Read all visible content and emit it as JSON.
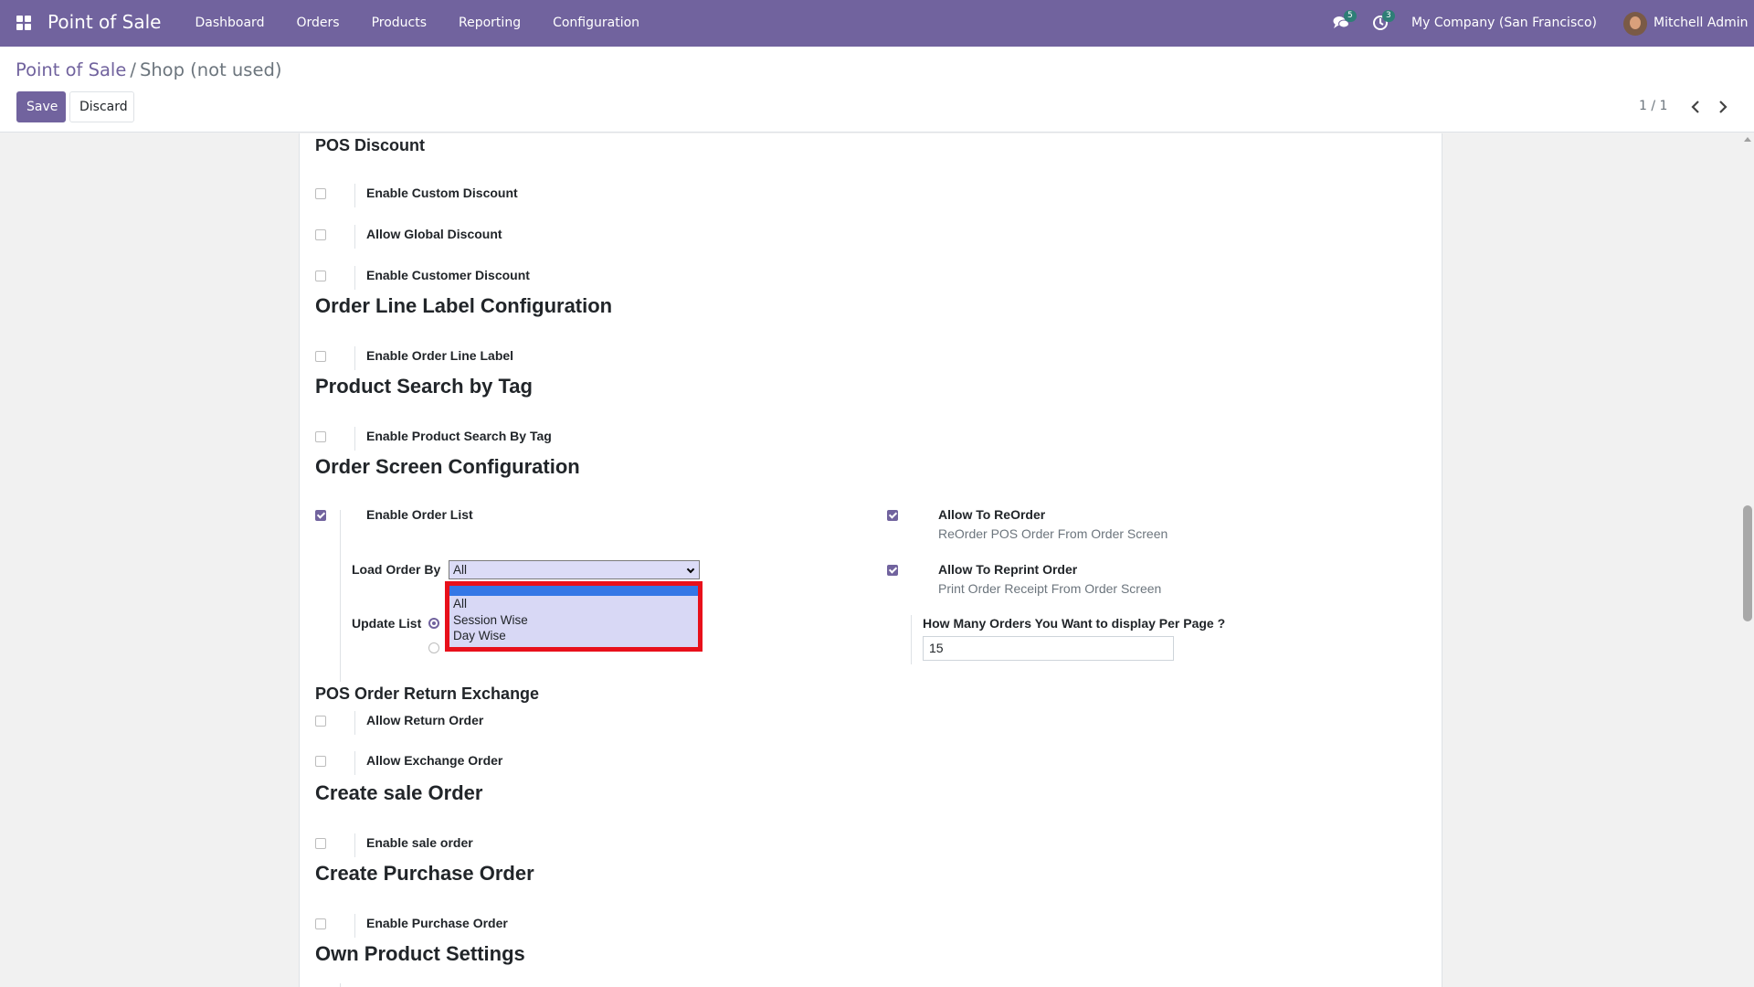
{
  "navbar": {
    "brand": "Point of Sale",
    "menu": [
      "Dashboard",
      "Orders",
      "Products",
      "Reporting",
      "Configuration"
    ],
    "chat_count": "5",
    "activity_count": "3",
    "company": "My Company (San Francisco)",
    "user": "Mitchell Admin"
  },
  "breadcrumb": {
    "parent": "Point of Sale",
    "separator": "/",
    "current": "Shop (not used)"
  },
  "buttons": {
    "save": "Save",
    "discard": "Discard"
  },
  "pager": "1 / 1",
  "sections": {
    "pos_discount": {
      "title": "POS Discount",
      "items": [
        {
          "label": "Enable Custom Discount",
          "checked": false
        },
        {
          "label": "Allow Global Discount",
          "checked": false
        },
        {
          "label": "Enable Customer Discount",
          "checked": false
        }
      ]
    },
    "order_line_label": {
      "title": "Order Line Label Configuration",
      "items": [
        {
          "label": "Enable Order Line Label",
          "checked": false
        }
      ]
    },
    "product_search": {
      "title": "Product Search by Tag",
      "items": [
        {
          "label": "Enable Product Search By Tag",
          "checked": false
        }
      ]
    },
    "order_screen": {
      "title": "Order Screen Configuration",
      "enable_order_list": {
        "label": "Enable Order List",
        "checked": true
      },
      "load_order_by": {
        "label": "Load Order By",
        "value": "All",
        "options": [
          "",
          "All",
          "Session Wise",
          "Day Wise"
        ]
      },
      "update_list": {
        "label": "Update List"
      },
      "allow_reorder": {
        "label": "Allow To ReOrder",
        "desc": "ReOrder POS Order From Order Screen",
        "checked": true
      },
      "allow_reprint": {
        "label": "Allow To Reprint Order",
        "desc": "Print Order Receipt From Order Screen",
        "checked": true
      },
      "orders_per_page": {
        "label": "How Many Orders You Want to display Per Page ?",
        "value": "15"
      }
    },
    "return_exchange": {
      "title": "POS Order Return Exchange",
      "items": [
        {
          "label": "Allow Return Order",
          "checked": false
        },
        {
          "label": "Allow Exchange Order",
          "checked": false
        }
      ]
    },
    "sale_order": {
      "title": "Create sale Order",
      "items": [
        {
          "label": "Enable sale order",
          "checked": false
        }
      ]
    },
    "purchase_order": {
      "title": "Create Purchase Order",
      "items": [
        {
          "label": "Enable Purchase Order",
          "checked": false
        }
      ]
    },
    "own_product": {
      "title": "Own Product Settings"
    }
  },
  "colors": {
    "navbar": "#71639e",
    "primary": "#71639e",
    "highlight_border": "#e8101b",
    "option_selected": "#3477e6"
  }
}
